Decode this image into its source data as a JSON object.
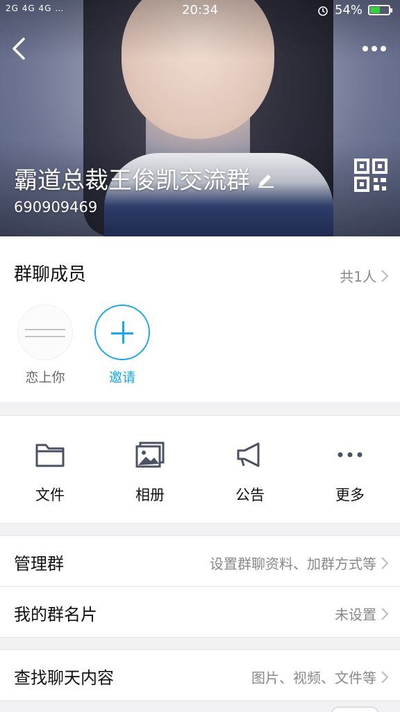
{
  "status_bar": {
    "signal": "2G 4G 4G …",
    "time": "20:34",
    "battery": "54%",
    "battery_level": 0.54,
    "battery_color": "#35d03f"
  },
  "header": {
    "group_name": "霸道总裁王俊凯交流群",
    "group_id": "690909469"
  },
  "members_section": {
    "title": "群聊成员",
    "count": "共1人",
    "members": [
      {
        "name": "恋上你"
      }
    ],
    "invite_label": "邀请"
  },
  "actions": [
    {
      "label": "文件",
      "icon": "folder-icon"
    },
    {
      "label": "相册",
      "icon": "album-icon"
    },
    {
      "label": "公告",
      "icon": "announcement-icon"
    },
    {
      "label": "更多",
      "icon": "more-icon"
    }
  ],
  "settings": {
    "manage_group": {
      "label": "管理群",
      "value": "设置群聊资料、加群方式等"
    },
    "my_card": {
      "label": "我的群名片",
      "value": "未设置"
    }
  },
  "search_chat": {
    "label": "查找聊天内容",
    "value": "图片、视频、文件等"
  },
  "colors": {
    "accent": "#19a9e5",
    "icon_gray": "#4a5263"
  }
}
